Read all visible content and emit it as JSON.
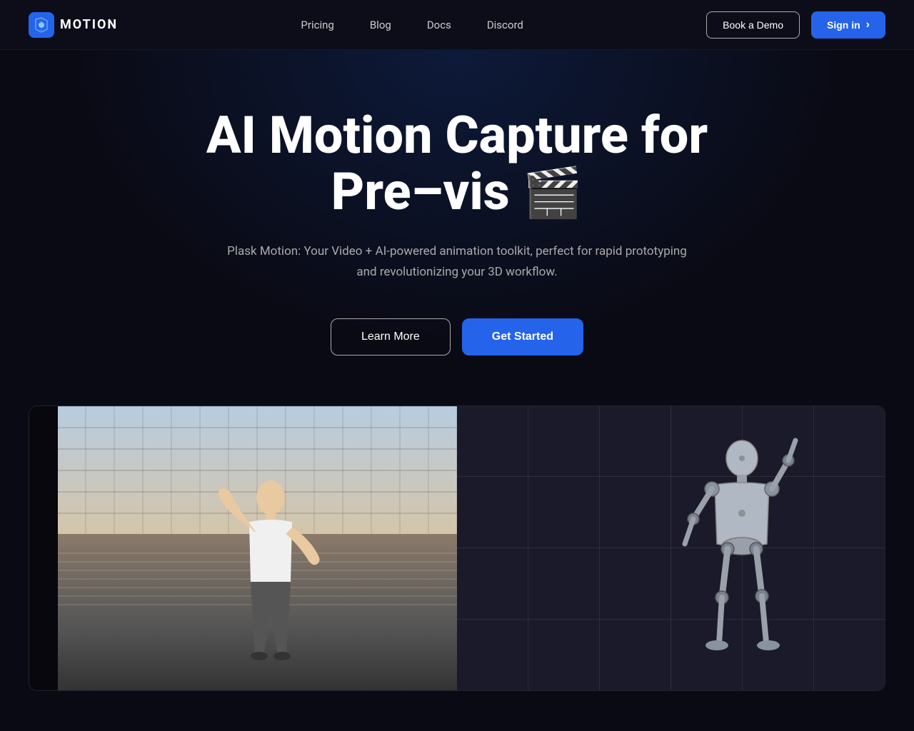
{
  "navbar": {
    "logo_text": "MOTION",
    "nav_items": [
      {
        "label": "Pricing",
        "id": "pricing"
      },
      {
        "label": "Blog",
        "id": "blog"
      },
      {
        "label": "Docs",
        "id": "docs"
      },
      {
        "label": "Discord",
        "id": "discord"
      }
    ],
    "book_demo_label": "Book a Demo",
    "signin_label": "Sign in",
    "signin_arrow": "›"
  },
  "hero": {
    "title_line1": "AI Motion Capture for",
    "title_line2": "Pre–vis",
    "title_emoji": "🎬",
    "subtitle": "Plask Motion: Your Video + AI-powered animation toolkit, perfect for rapid prototyping and revolutionizing your 3D workflow.",
    "learn_more_label": "Learn More",
    "get_started_label": "Get Started"
  },
  "demo": {
    "left_alt": "Person motion capture source video",
    "right_alt": "3D skeleton animation output"
  }
}
